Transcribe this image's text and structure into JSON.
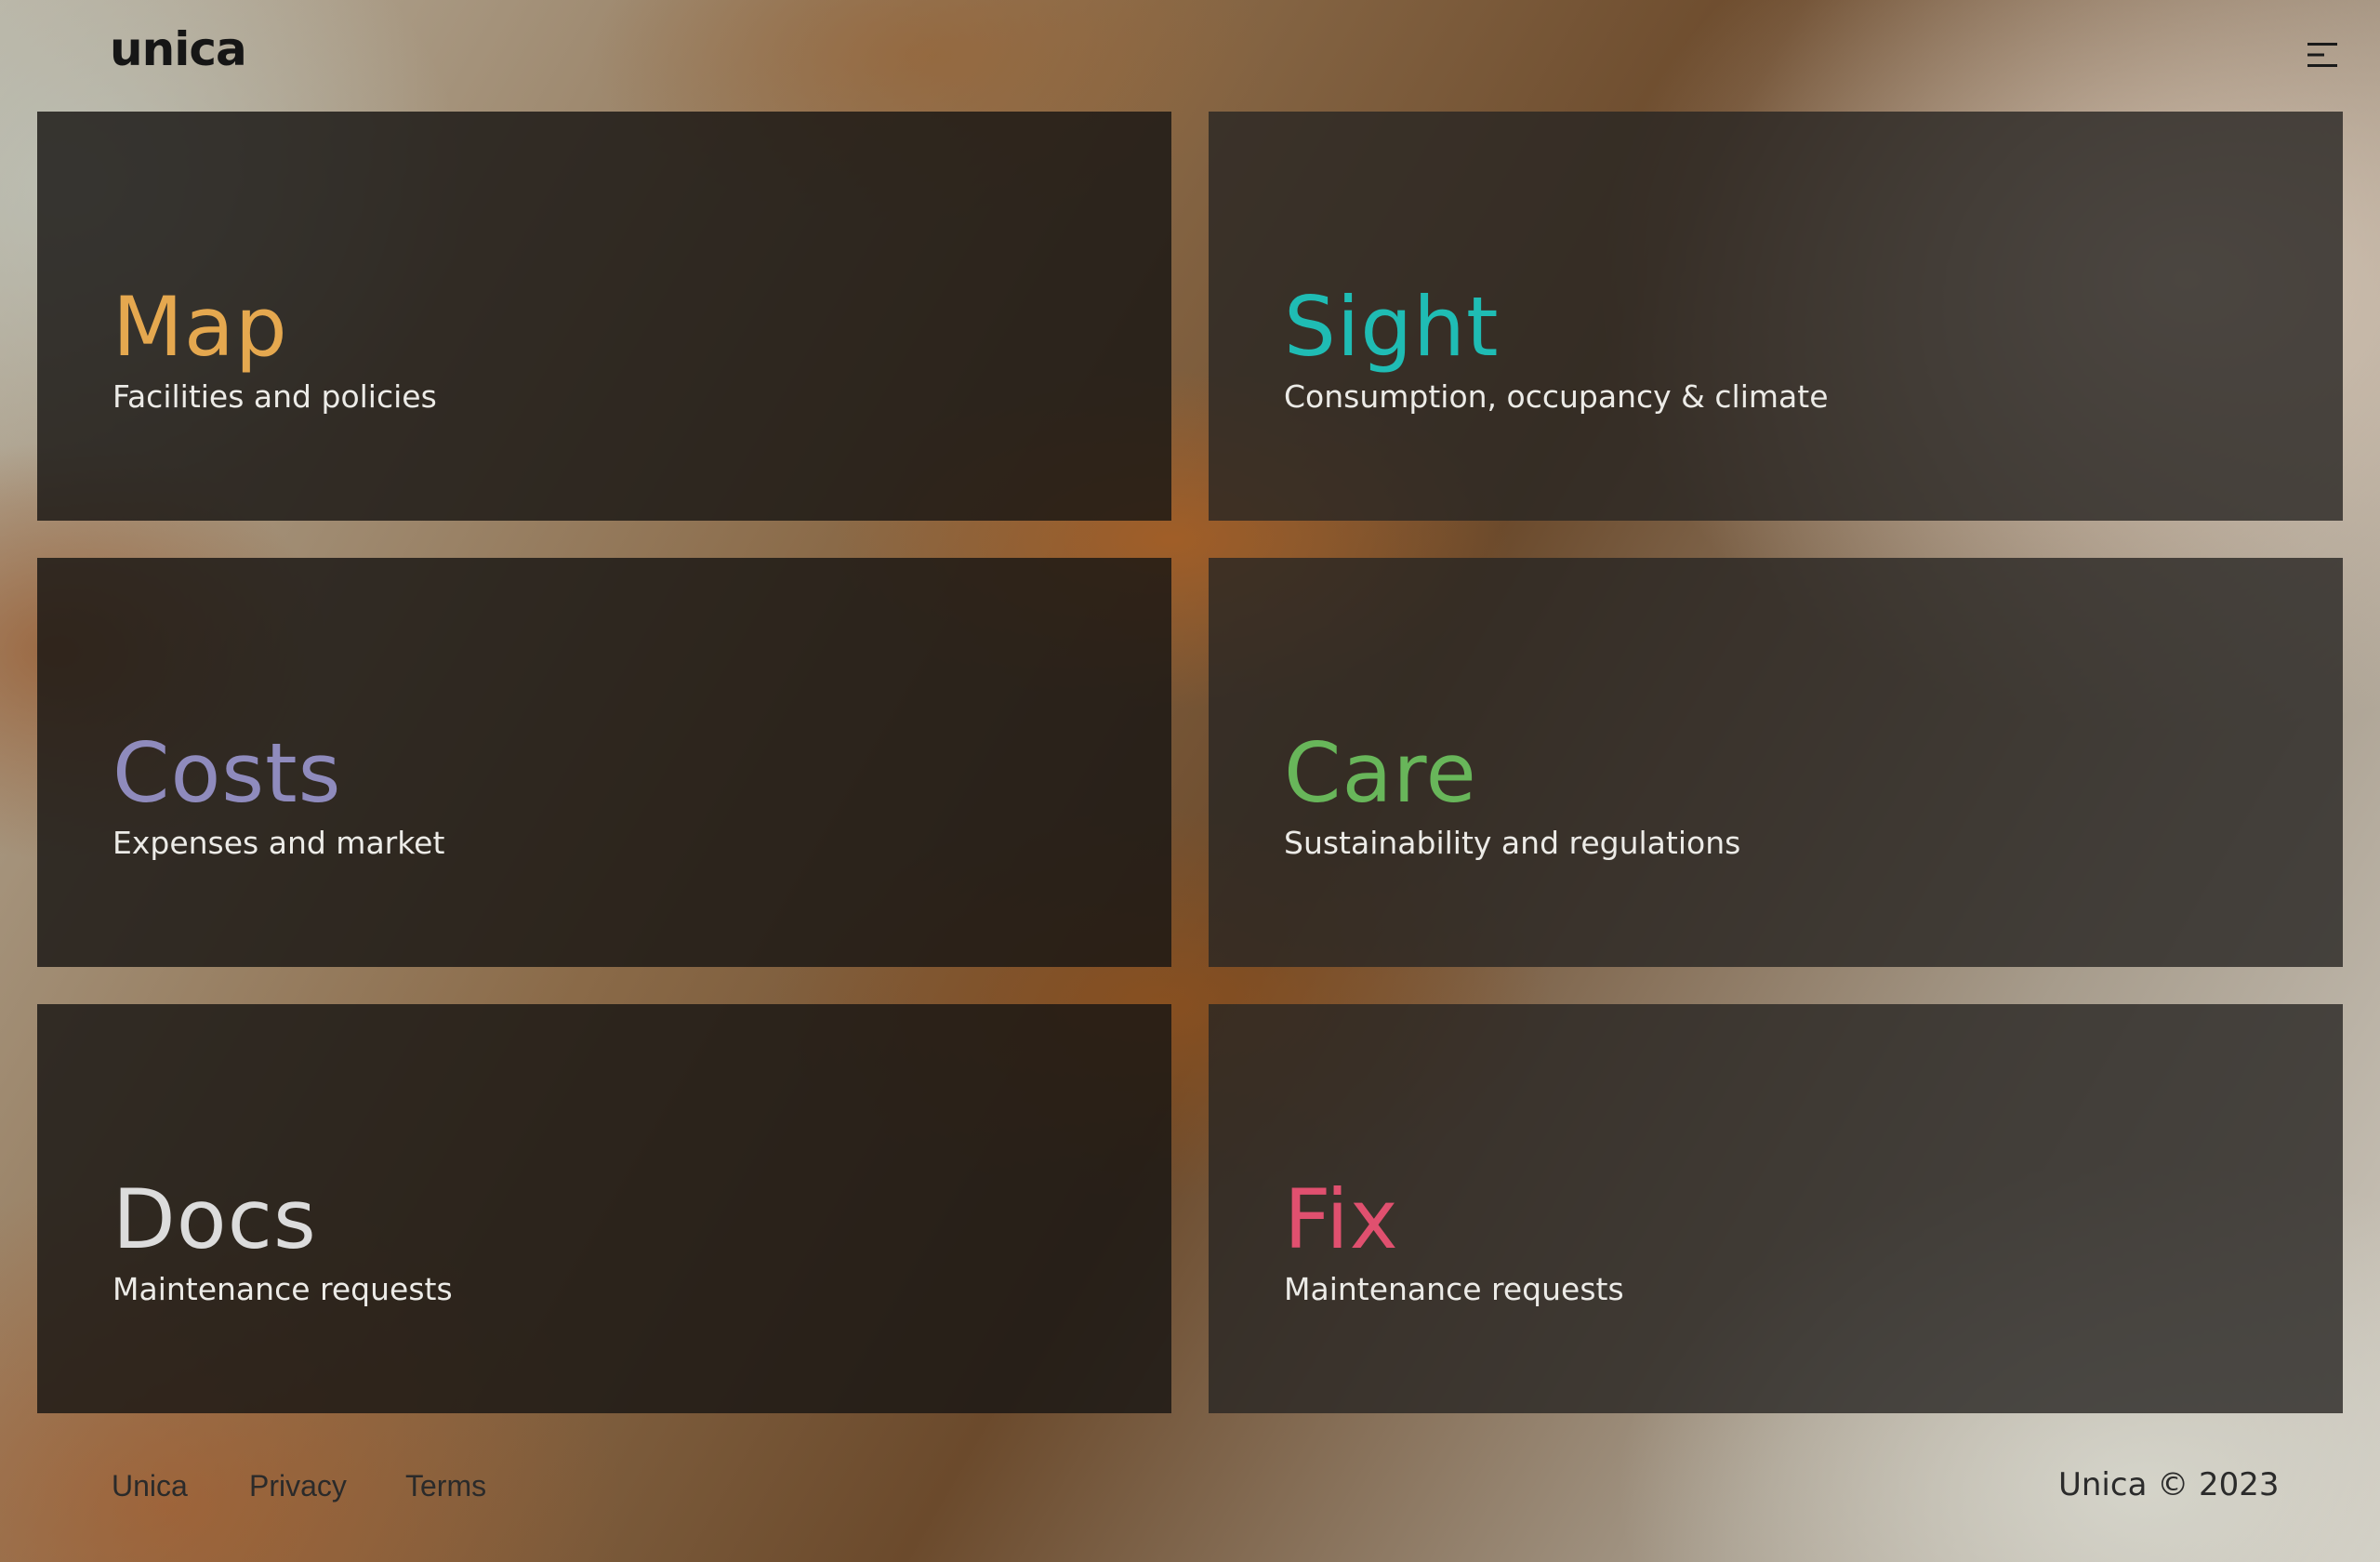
{
  "header": {
    "logo_text": "unica",
    "menu_icon": "menu-icon"
  },
  "tiles": [
    {
      "title": "Map",
      "subtitle": "Facilities and policies",
      "color": "#e5a84f"
    },
    {
      "title": "Sight",
      "subtitle": "Consumption, occupancy & climate",
      "color": "#1fbcb4"
    },
    {
      "title": "Costs",
      "subtitle": "Expenses and market",
      "color": "#8f8bbd"
    },
    {
      "title": "Care",
      "subtitle": "Sustainability and regulations",
      "color": "#68b65a"
    },
    {
      "title": "Docs",
      "subtitle": "Maintenance requests",
      "color": "#dcdcdc"
    },
    {
      "title": "Fix",
      "subtitle": "Maintenance requests",
      "color": "#e0506f"
    }
  ],
  "footer": {
    "links": [
      "Unica",
      "Privacy",
      "Terms"
    ],
    "copyright": "Unica © 2023"
  }
}
